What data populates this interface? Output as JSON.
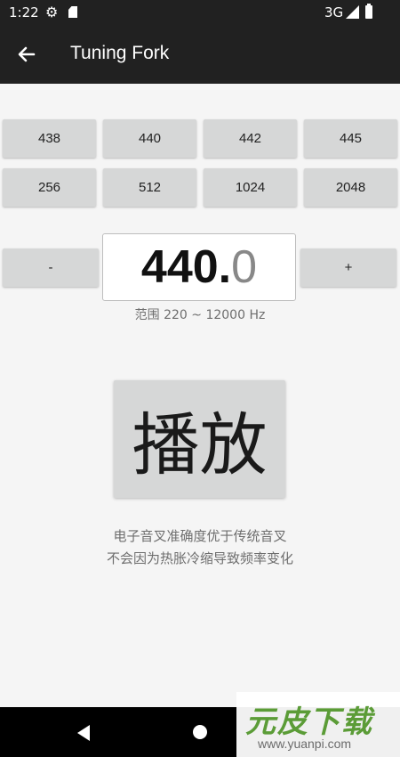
{
  "status_bar": {
    "time": "1:22",
    "network": "3G",
    "icons": [
      "gear-icon",
      "sd-card-icon",
      "signal-icon",
      "battery-icon"
    ]
  },
  "app_bar": {
    "title": "Tuning Fork",
    "back_icon": "arrow-left-icon"
  },
  "presets": [
    {
      "label": "438"
    },
    {
      "label": "440"
    },
    {
      "label": "442"
    },
    {
      "label": "445"
    },
    {
      "label": "256"
    },
    {
      "label": "512"
    },
    {
      "label": "1024"
    },
    {
      "label": "2048"
    }
  ],
  "stepper": {
    "minus_label": "-",
    "plus_label": "+",
    "value_integer": "440.",
    "value_decimal": "0",
    "range_text": "范围 220 ~ 12000 Hz"
  },
  "play": {
    "label": "播放"
  },
  "description": {
    "line1": "电子音叉准确度优于传统音叉",
    "line2": "不会因为热胀冷缩导致频率变化"
  },
  "nav_bar": {
    "icons": [
      "nav-back-icon",
      "nav-home-icon"
    ]
  },
  "watermark": {
    "title": "元皮下载",
    "url": "www.yuanpi.com"
  },
  "colors": {
    "bar_background": "#212121",
    "page_background": "#f5f5f5",
    "button_background": "#d6d7d7",
    "watermark_green": "#5b9c37"
  }
}
